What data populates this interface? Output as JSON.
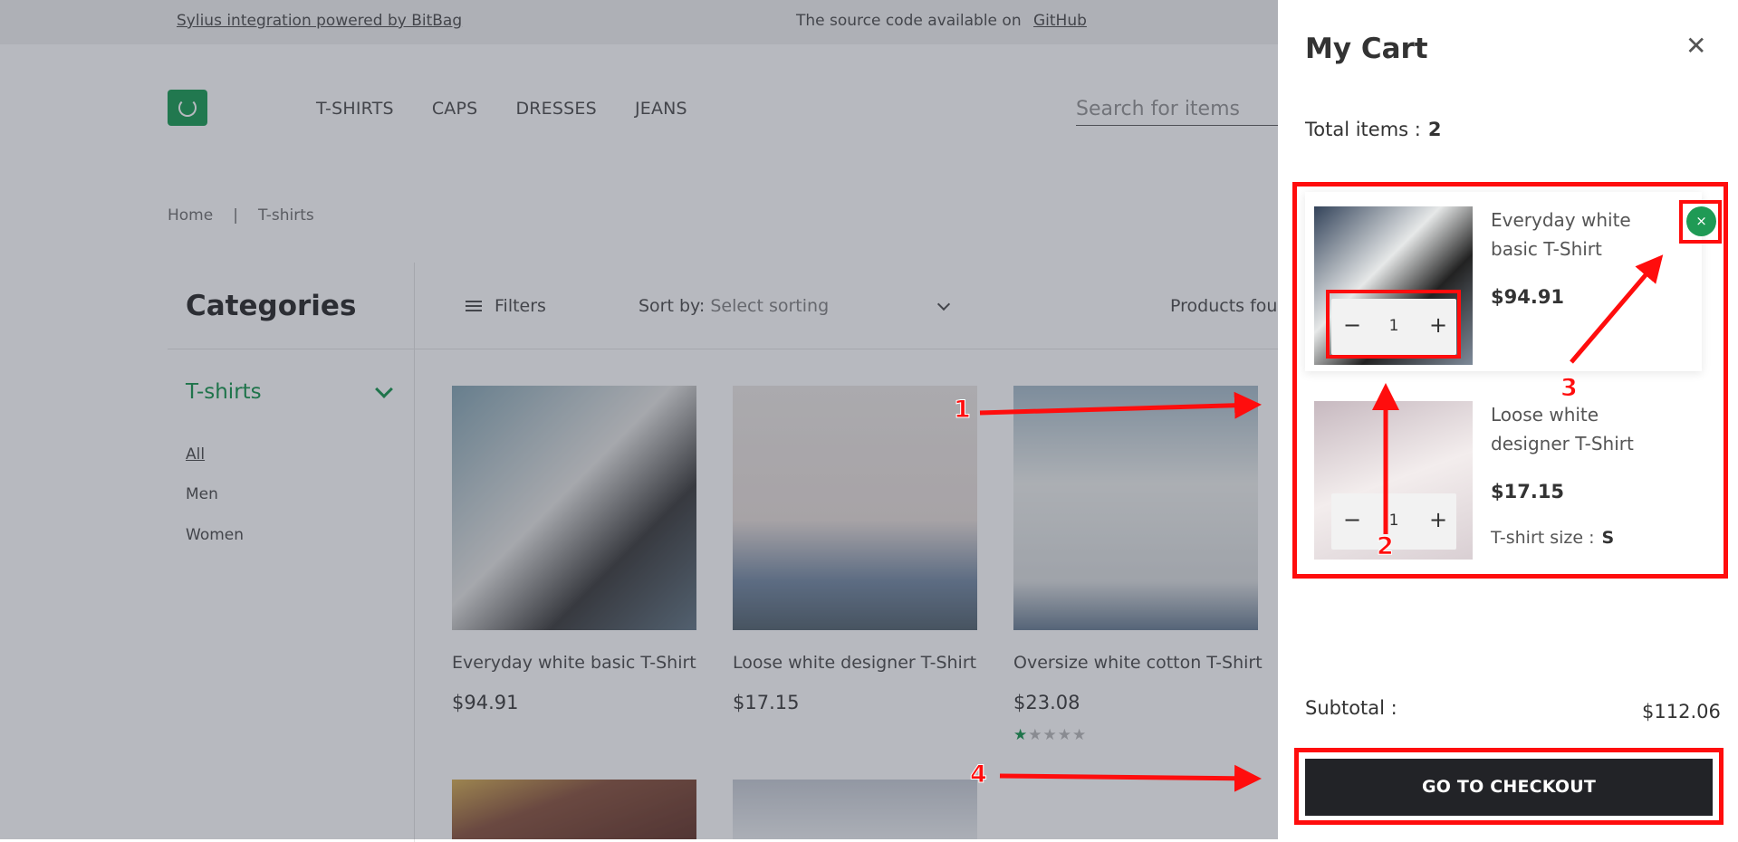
{
  "topbar": {
    "left_link": "Sylius integration powered by BitBag",
    "right_text": "The source code available on",
    "right_link": "GitHub"
  },
  "nav": {
    "items": [
      "T-SHIRTS",
      "CAPS",
      "DRESSES",
      "JEANS"
    ],
    "search_placeholder": "Search for items"
  },
  "breadcrumb": {
    "home": "Home",
    "separator": "|",
    "current": "T-shirts"
  },
  "sidebar": {
    "title": "Categories",
    "category": "T-shirts",
    "subcategories": [
      "All",
      "Men",
      "Women"
    ]
  },
  "toolbar": {
    "filters_label": "Filters",
    "sort_label": "Sort by:",
    "sort_value": "Select sorting",
    "products_found": "Products fou"
  },
  "products": [
    {
      "name": "Everyday white basic T-Shirt",
      "price": "$94.91"
    },
    {
      "name": "Loose white designer T-Shirt",
      "price": "$17.15"
    },
    {
      "name": "Oversize white cotton T-Shirt",
      "price": "$23.08",
      "rating": 1,
      "rating_max": 5
    }
  ],
  "cart": {
    "title": "My Cart",
    "close_icon": "close-icon",
    "total_items_label": "Total items :",
    "total_items_value": "2",
    "items": [
      {
        "name": "Everyday white basic T-Shirt",
        "price": "$94.91",
        "quantity": "1",
        "minus": "−",
        "plus": "+",
        "remove": "×"
      },
      {
        "name": "Loose white designer T-Shirt",
        "price": "$17.15",
        "quantity": "1",
        "minus": "−",
        "plus": "+",
        "size_label": "T-shirt size :",
        "size_value": "S"
      }
    ],
    "subtotal_label": "Subtotal :",
    "subtotal_value": "$112.06",
    "checkout_label": "GO TO CHECKOUT"
  },
  "annotations": [
    "1",
    "2",
    "3",
    "4"
  ],
  "colors": {
    "accent_green": "#1f9a55",
    "annotation_red": "#ff0d0d",
    "checkout_bg": "#222327",
    "overlay": "rgba(30,38,56,0.32)"
  }
}
